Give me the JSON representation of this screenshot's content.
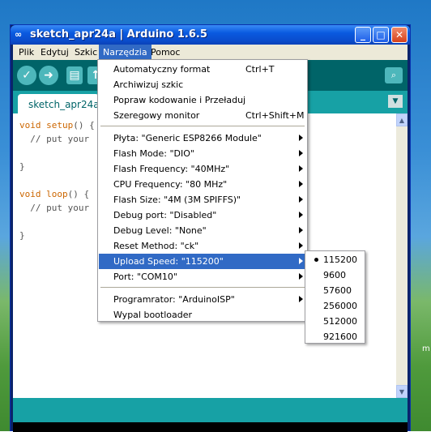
{
  "window": {
    "title": "sketch_apr24a | Arduino 1.6.5"
  },
  "menubar": {
    "items": [
      "Plik",
      "Edytuj",
      "Szkic",
      "Narzędzia",
      "Pomoc"
    ]
  },
  "tab": {
    "label": "sketch_apr24a"
  },
  "code": {
    "lines": [
      "void setup() {",
      "  // put your",
      "",
      "}",
      "",
      "void loop() {",
      "  // put your",
      "",
      "}"
    ]
  },
  "dropdown": {
    "items": [
      {
        "label": "Automatyczny format",
        "shortcut": "Ctrl+T"
      },
      {
        "label": "Archiwizuj szkic",
        "shortcut": ""
      },
      {
        "label": "Popraw kodowanie i Przeładuj",
        "shortcut": ""
      },
      {
        "label": "Szeregowy monitor",
        "shortcut": "Ctrl+Shift+M"
      },
      {
        "label": "Płyta: \"Generic ESP8266 Module\"",
        "submenu": true
      },
      {
        "label": "Flash Mode: \"DIO\"",
        "submenu": true
      },
      {
        "label": "Flash Frequency: \"40MHz\"",
        "submenu": true
      },
      {
        "label": "CPU Frequency: \"80 MHz\"",
        "submenu": true
      },
      {
        "label": "Flash Size: \"4M (3M SPIFFS)\"",
        "submenu": true
      },
      {
        "label": "Debug port: \"Disabled\"",
        "submenu": true
      },
      {
        "label": "Debug Level: \"None\"",
        "submenu": true
      },
      {
        "label": "Reset Method: \"ck\"",
        "submenu": true
      },
      {
        "label": "Upload Speed: \"115200\"",
        "submenu": true,
        "highlighted": true
      },
      {
        "label": "Port: \"COM10\"",
        "submenu": true
      },
      {
        "label": "Programrator: \"ArduinoISP\"",
        "submenu": true
      },
      {
        "label": "Wypal bootloader",
        "shortcut": ""
      }
    ]
  },
  "submenu": {
    "selected": "115200",
    "items": [
      "115200",
      "9600",
      "57600",
      "256000",
      "512000",
      "921600"
    ]
  },
  "desktop": {
    "label": "m"
  },
  "colors": {
    "teal_dark": "#006468",
    "teal": "#17a1a5",
    "highlight": "#316ac5"
  }
}
